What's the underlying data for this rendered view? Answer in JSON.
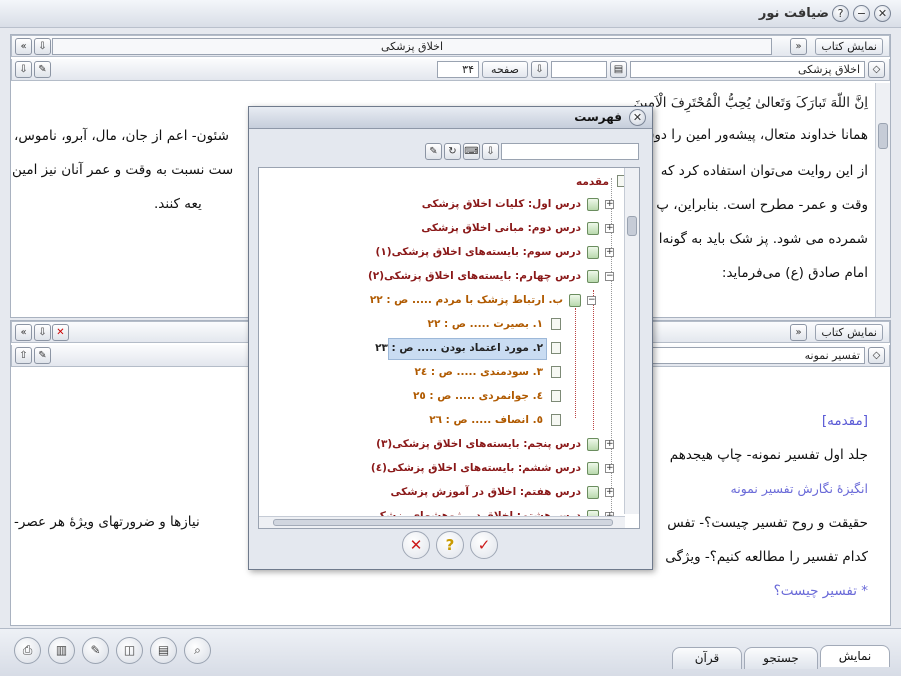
{
  "app": {
    "title": "ضیافت نور"
  },
  "top": {
    "show_book": "نمایش کتاب",
    "title": "اخلاق پزشکی",
    "book_field": "اخلاق پزشکی",
    "page_label": "صفحه",
    "page_value": "۳۴",
    "lines": [
      "اِنَّ اللّهَ تَبارَکَ وَتَعالیٰ یُحِبُّ الْمُحْتَرِفَ الْاَمینَ",
      "همانا خداوند متعال، پیشه‌ور امین را دوست دارد",
      "از این روایت می‌توان استفاده کرد که",
      "وقت و عمر- مطرح است. بنابراین، پ",
      "شمرده می شود. پز شک باید به گونه‌ا",
      "امام صادق (ع) می‌فرماید:"
    ],
    "right_tail": [
      "شئون- اعم از جان، مال، آبرو، ناموس،",
      "ست نسبت به وقت و عمر آنان نیز امین",
      "یعه کنند."
    ]
  },
  "bottom_pane": {
    "show_book": "نمایش کتاب",
    "book_field": "تفسیر نمونه",
    "lines": [
      "[مقدمه]",
      "جلد اول تفسیر نمونه- چاپ هیجدهم",
      "انگیزۀ نگارش تفسیر نمونه",
      "حقیقت و روح تفسیر چیست؟- تفس",
      "کدام تفسیر را مطالعه کنیم؟- ویژگی",
      "* تفسیر چیست؟"
    ],
    "right_tail": "نیازها و ضرورتهای ویژۀ هر عصر-"
  },
  "dialog": {
    "title": "فهرست",
    "items": [
      {
        "label": "مقدمه",
        "color": "red"
      },
      {
        "label": "درس اول: کلیات اخلاق پزشکی",
        "color": "red"
      },
      {
        "label": "درس دوم: مبانی اخلاق پزشکی",
        "color": "red"
      },
      {
        "label": "درس سوم: بایسته‌های اخلاق پزشکی(۱)",
        "color": "red"
      },
      {
        "label": "درس چهارم: بایسته‌های اخلاق پزشکی(۲)",
        "color": "red"
      },
      {
        "label": "ب. ارتباط پزشک با مردم ..... ص : ۲۲",
        "color": "orange"
      },
      {
        "label": "۱. بصیرت ..... ص : ۲۲",
        "color": "orange"
      },
      {
        "label": "۲. مورد اعتماد بودن ..... ص : ۲۳",
        "color": "dark"
      },
      {
        "label": "۳. سودمندی ..... ص : ۲٤",
        "color": "orange"
      },
      {
        "label": "٤. جوانمردی ..... ص : ۲٥",
        "color": "orange"
      },
      {
        "label": "٥. انصاف ..... ص : ۲٦",
        "color": "orange"
      },
      {
        "label": "درس پنجم: بایسته‌های اخلاق پزشکی(۳)",
        "color": "red"
      },
      {
        "label": "درس ششم: بایسته‌های اخلاق پزشکی(٤)",
        "color": "red"
      },
      {
        "label": "درس هفتم: اخلاق در آموزش پزشکی",
        "color": "red"
      },
      {
        "label": "درس هشتم: اخلاق در پژوهشهای پزشکی",
        "color": "red"
      }
    ]
  },
  "tabs": [
    "نمایش",
    "جستجو",
    "قرآن"
  ]
}
